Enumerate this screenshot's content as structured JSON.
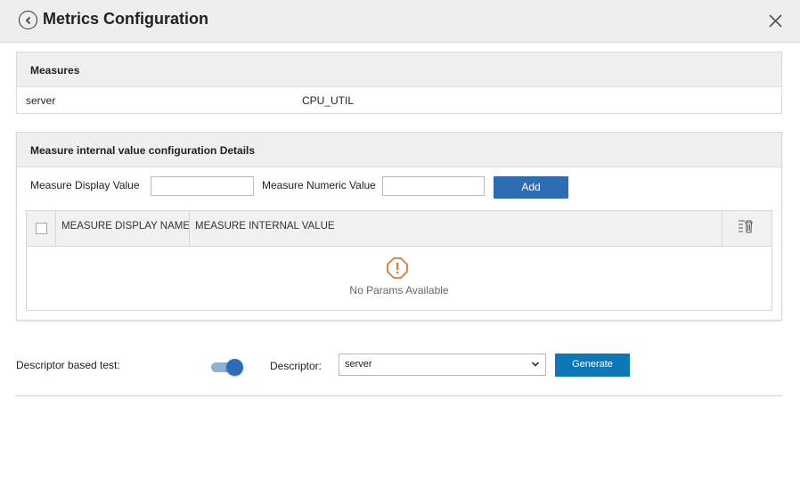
{
  "header": {
    "title": "Metrics Configuration",
    "back_icon": "chevron-left-circle-icon",
    "close_icon": "close-icon"
  },
  "measures": {
    "heading": "Measures",
    "rows": [
      {
        "name": "server",
        "value": "CPU_UTIL"
      }
    ]
  },
  "details": {
    "heading": "Measure internal value configuration Details",
    "display_label": "Measure Display Value",
    "display_value": "",
    "numeric_label": "Measure Numeric Value",
    "numeric_value": "",
    "add_label": "Add",
    "columns": [
      "MEASURE DISPLAY NAME",
      "MEASURE INTERNAL VALUE"
    ],
    "empty_text": "No Params Available"
  },
  "descriptor": {
    "test_label": "Descriptor based test:",
    "toggle_on": true,
    "label": "Descriptor:",
    "selected": "server",
    "generate_label": "Generate"
  },
  "colors": {
    "primary": "#2e6cb5",
    "generate": "#0e77b7",
    "warning": "#e8772e"
  }
}
